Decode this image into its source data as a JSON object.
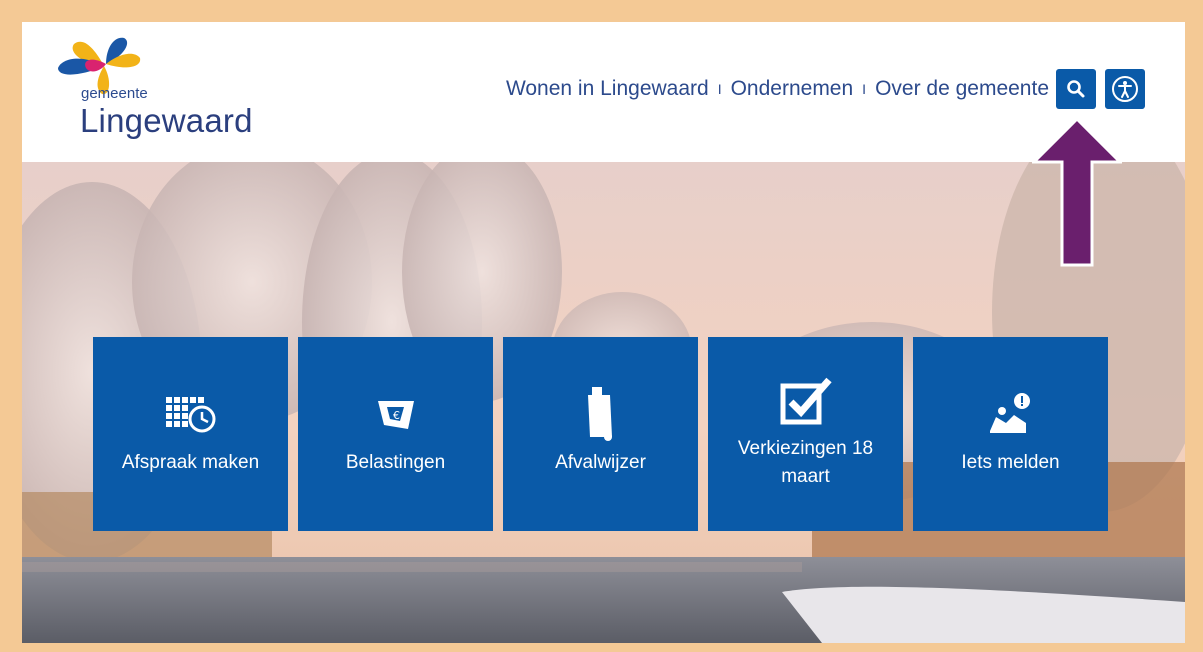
{
  "header": {
    "logo_small": "gemeente",
    "logo_big": "Lingewaard",
    "nav": [
      {
        "label": "Wonen in Lingewaard"
      },
      {
        "label": "Ondernemen"
      },
      {
        "label": "Over de gemeente"
      }
    ],
    "separator": "I",
    "search_icon": "search-icon",
    "accessibility_icon": "accessibility-icon"
  },
  "tiles": [
    {
      "label": "Afspraak maken",
      "icon": "calendar-clock-icon"
    },
    {
      "label": "Belastingen",
      "icon": "tax-document-icon"
    },
    {
      "label": "Afvalwijzer",
      "icon": "waste-bin-icon"
    },
    {
      "label": "Verkiezingen 18 maart",
      "icon": "checkbox-icon"
    },
    {
      "label": "Iets melden",
      "icon": "report-issue-icon"
    }
  ],
  "colors": {
    "frame": "#f4c995",
    "brand_blue": "#0a5aa8",
    "nav_text": "#2c4a8c",
    "arrow": "#6a1f6d"
  }
}
